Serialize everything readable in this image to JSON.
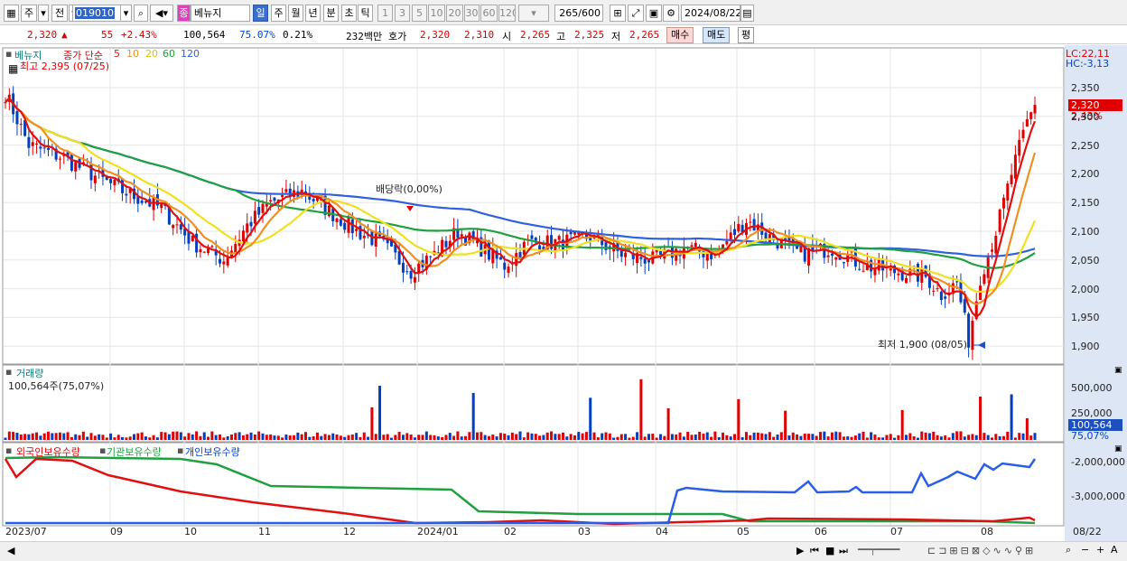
{
  "toolbar": {
    "mode1": "주",
    "mode2": "전",
    "code": "019010",
    "name": "베뉴지",
    "name_badge": "종",
    "periods": [
      "일",
      "주",
      "월",
      "년",
      "분",
      "초",
      "틱"
    ],
    "intervals": [
      "1",
      "3",
      "5",
      "10",
      "20",
      "30",
      "60",
      "120"
    ],
    "count": "265",
    "count_total": "/600",
    "date": "2024/08/22"
  },
  "quote": {
    "price": "2,320",
    "change": "55",
    "change_pct": "+2.43%",
    "volume": "100,564",
    "volume_ratio": "75.07%",
    "turnover": "0.21%",
    "amount": "232백만",
    "hoga_label": "호가",
    "ask": "2,320",
    "bid": "2,310",
    "open_label": "시",
    "open": "2,265",
    "high_label": "고",
    "high": "2,325",
    "low_label": "저",
    "low": "2,265",
    "buy": "매수",
    "sell": "매도",
    "eq": "평"
  },
  "price_panel": {
    "name": "베뉴지",
    "ma_label": "종가 단순",
    "ma_periods": [
      "5",
      "10",
      "20",
      "60",
      "120"
    ],
    "high_note": "최고 2,395 (07/25)",
    "low_note": "최저 1,900 (08/05)",
    "dividend": "배당락(0,00%)",
    "lc": "LC:22,11",
    "hc": "HC:-3,13",
    "last_price": "2,320",
    "last_pct": "2,43%",
    "y_ticks": [
      "2,350",
      "2,300",
      "2,250",
      "2,200",
      "2,150",
      "2,100",
      "2,050",
      "2,000",
      "1,950",
      "1,900"
    ]
  },
  "volume_panel": {
    "title": "거래량",
    "value": "100,564주(75,07%)",
    "y_tick": "500,000",
    "y_tick2": "250,000",
    "last": "100,564",
    "last_pct": "75,07%"
  },
  "holding_panel": {
    "foreign": "외국인보유수량",
    "inst": "기관보유수량",
    "indiv": "개인보유수량",
    "y_ticks": [
      "-2,000,000",
      "-3,000,000"
    ]
  },
  "x_ticks": [
    "2023/07",
    "09",
    "10",
    "11",
    "12",
    "2024/01",
    "02",
    "03",
    "04",
    "05",
    "06",
    "07",
    "08",
    "08/22"
  ],
  "colors": {
    "ma5": "#e01010",
    "ma10": "#f09020",
    "ma20": "#f0e020",
    "ma60": "#20a040",
    "ma120": "#3060e0",
    "up": "#e00000",
    "down": "#0040c0"
  }
}
